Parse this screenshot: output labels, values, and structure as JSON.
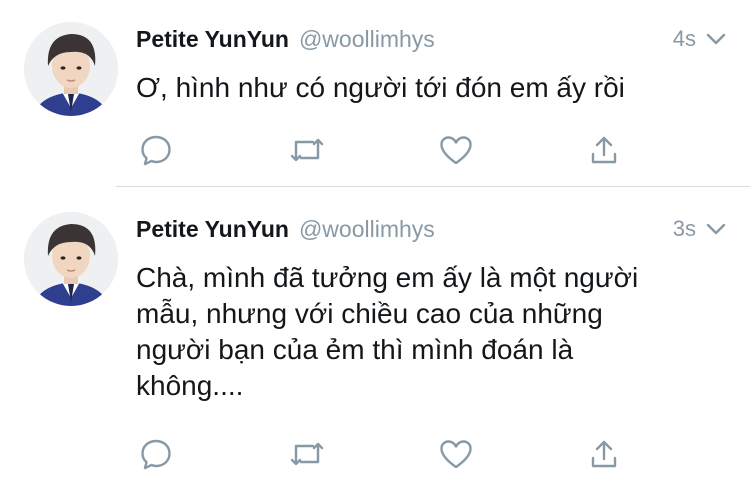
{
  "tweets": [
    {
      "display_name": "Petite YunYun",
      "handle": "@woollimhys",
      "time": "4s",
      "text": "Ơ, hình như có người tới đón em ấy rồi"
    },
    {
      "display_name": "Petite YunYun",
      "handle": "@woollimhys",
      "time": "3s",
      "text": "Chà, mình đã tưởng em ấy là một người\nmẫu, nhưng với chiều cao của những\nngười bạn của ẻm thì mình đoán là\nkhông...."
    }
  ],
  "icons": {
    "reply": "reply-icon",
    "retweet": "retweet-icon",
    "like": "heart-icon",
    "share": "share-icon",
    "more": "chevron-down-icon"
  },
  "colors": {
    "icon": "#8899a6",
    "name": "#14171a",
    "secondary": "#8899a6",
    "divider": "#d6dbe0"
  }
}
